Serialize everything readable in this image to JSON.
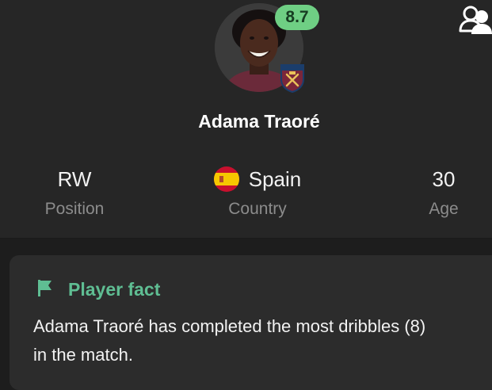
{
  "player": {
    "rating": "8.7",
    "name": "Adama Traoré",
    "club_crest_text": "WEST HAM UNITED"
  },
  "stats": {
    "position": {
      "value": "RW",
      "label": "Position"
    },
    "country": {
      "value": "Spain",
      "label": "Country"
    },
    "age": {
      "value": "30",
      "label": "Age"
    }
  },
  "fact": {
    "title": "Player fact",
    "text": "Adama Traoré has completed the most dribbles (8) in the match."
  },
  "icons": {
    "compare": "compare-players-icon",
    "flag": "flag-icon",
    "country_flag": "spain-flag-icon"
  },
  "colors": {
    "rating_badge": "#6fcf84",
    "accent": "#5fbe93",
    "background": "#242424",
    "card": "#2c2c2c"
  }
}
